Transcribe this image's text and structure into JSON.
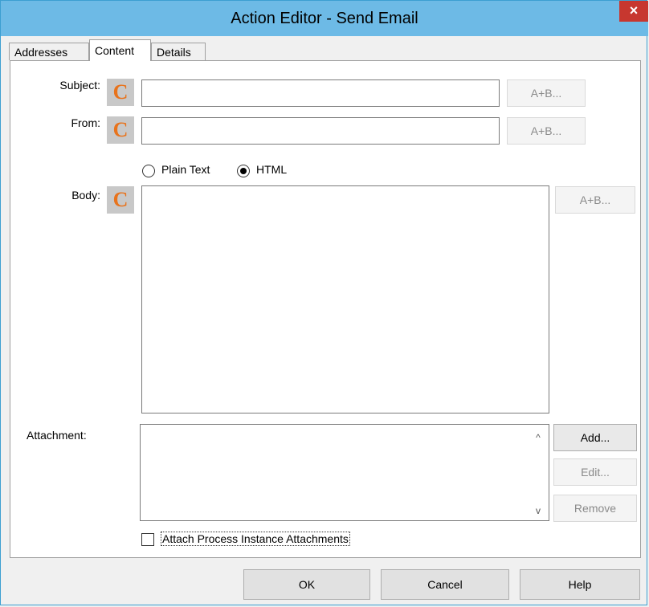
{
  "window": {
    "title": "Action Editor - Send Email",
    "close_glyph": "×"
  },
  "tabs": [
    {
      "label": "Addresses"
    },
    {
      "label": "Content"
    },
    {
      "label": "Details"
    }
  ],
  "active_tab": "Content",
  "fields": {
    "subject": {
      "label": "Subject:",
      "value": "",
      "expr_button": "A+B..."
    },
    "from": {
      "label": "From:",
      "value": "",
      "expr_button": "A+B..."
    },
    "body": {
      "label": "Body:",
      "value": "",
      "expr_button": "A+B..."
    }
  },
  "constant_icon": "C",
  "format": {
    "plain_text_label": "Plain Text",
    "html_label": "HTML",
    "selected": "HTML"
  },
  "attachment": {
    "label": "Attachment:",
    "items": [],
    "add_label": "Add...",
    "edit_label": "Edit...",
    "remove_label": "Remove"
  },
  "attach_process": {
    "label": "Attach Process Instance Attachments",
    "checked": false
  },
  "footer": {
    "ok_label": "OK",
    "cancel_label": "Cancel",
    "help_label": "Help"
  },
  "icons": {
    "scroll_up": "^",
    "scroll_down": "v"
  },
  "colors": {
    "titlebar": "#6dbae6",
    "close": "#c7372f",
    "constant_icon": "#e8731c"
  }
}
